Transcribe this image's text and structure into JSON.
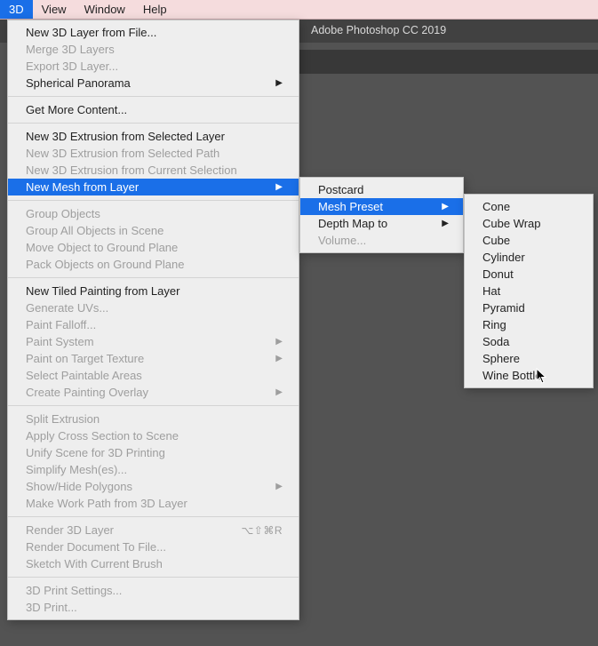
{
  "app_title": "Adobe Photoshop CC 2019",
  "menubar": {
    "items": [
      "3D",
      "View",
      "Window",
      "Help"
    ],
    "active_index": 0
  },
  "menu3d": {
    "groups": [
      [
        {
          "label": "New 3D Layer from File...",
          "enabled": true
        },
        {
          "label": "Merge 3D Layers",
          "enabled": false
        },
        {
          "label": "Export 3D Layer...",
          "enabled": false
        },
        {
          "label": "Spherical Panorama",
          "enabled": true,
          "submenu": true
        }
      ],
      [
        {
          "label": "Get More Content...",
          "enabled": true
        }
      ],
      [
        {
          "label": "New 3D Extrusion from Selected Layer",
          "enabled": true
        },
        {
          "label": "New 3D Extrusion from Selected Path",
          "enabled": false
        },
        {
          "label": "New 3D Extrusion from Current Selection",
          "enabled": false
        },
        {
          "label": "New Mesh from Layer",
          "enabled": true,
          "submenu": true,
          "highlighted": true
        }
      ],
      [
        {
          "label": "Group Objects",
          "enabled": false
        },
        {
          "label": "Group All Objects in Scene",
          "enabled": false
        },
        {
          "label": "Move Object to Ground Plane",
          "enabled": false
        },
        {
          "label": "Pack Objects on Ground Plane",
          "enabled": false
        }
      ],
      [
        {
          "label": "New Tiled Painting from Layer",
          "enabled": true
        },
        {
          "label": "Generate UVs...",
          "enabled": false
        },
        {
          "label": "Paint Falloff...",
          "enabled": false
        },
        {
          "label": "Paint System",
          "enabled": false,
          "submenu": true
        },
        {
          "label": "Paint on Target Texture",
          "enabled": false,
          "submenu": true
        },
        {
          "label": "Select Paintable Areas",
          "enabled": false
        },
        {
          "label": "Create Painting Overlay",
          "enabled": false,
          "submenu": true
        }
      ],
      [
        {
          "label": "Split Extrusion",
          "enabled": false
        },
        {
          "label": "Apply Cross Section to Scene",
          "enabled": false
        },
        {
          "label": "Unify Scene for 3D Printing",
          "enabled": false
        },
        {
          "label": "Simplify Mesh(es)...",
          "enabled": false
        },
        {
          "label": "Show/Hide Polygons",
          "enabled": false,
          "submenu": true
        },
        {
          "label": "Make Work Path from 3D Layer",
          "enabled": false
        }
      ],
      [
        {
          "label": "Render 3D Layer",
          "enabled": false,
          "shortcut": "⌥⇧⌘R"
        },
        {
          "label": "Render Document To File...",
          "enabled": false
        },
        {
          "label": "Sketch With Current Brush",
          "enabled": false
        }
      ],
      [
        {
          "label": "3D Print Settings...",
          "enabled": false
        },
        {
          "label": "3D Print...",
          "enabled": false
        }
      ]
    ]
  },
  "submenu_newmesh": {
    "items": [
      {
        "label": "Postcard",
        "enabled": true
      },
      {
        "label": "Mesh Preset",
        "enabled": true,
        "submenu": true,
        "highlighted": true
      },
      {
        "label": "Depth Map to",
        "enabled": true,
        "submenu": true
      },
      {
        "label": "Volume...",
        "enabled": false
      }
    ]
  },
  "submenu_meshpreset": {
    "items": [
      "Cone",
      "Cube Wrap",
      "Cube",
      "Cylinder",
      "Donut",
      "Hat",
      "Pyramid",
      "Ring",
      "Soda",
      "Sphere",
      "Wine Bottle"
    ]
  }
}
